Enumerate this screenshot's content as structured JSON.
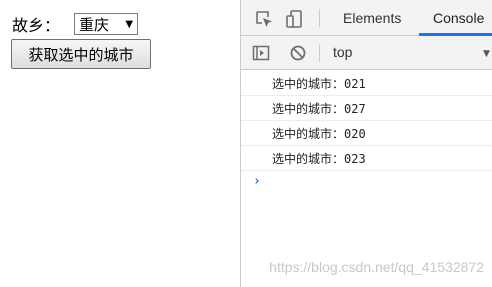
{
  "page": {
    "hometown_label": "故乡：",
    "city_select": {
      "selected": "重庆"
    },
    "get_city_button": "获取选中的城市"
  },
  "devtools": {
    "tabs": [
      {
        "label": "Elements",
        "active": false
      },
      {
        "label": "Console",
        "active": true
      }
    ],
    "context": "top",
    "console_lines": [
      "选中的城市：021",
      "选中的城市：027",
      "选中的城市：020",
      "选中的城市：023"
    ],
    "prompt": "›"
  },
  "watermark": "https://blog.csdn.net/qq_41532872",
  "colors": {
    "accent": "#1a73e8",
    "panel_bg": "#f3f3f3",
    "border": "#cccccc"
  },
  "icons": [
    "inspect-icon",
    "device-toggle-icon",
    "sidebar-toggle-icon",
    "clear-console-icon",
    "context-dropdown-icon",
    "select-arrow-icon"
  ]
}
